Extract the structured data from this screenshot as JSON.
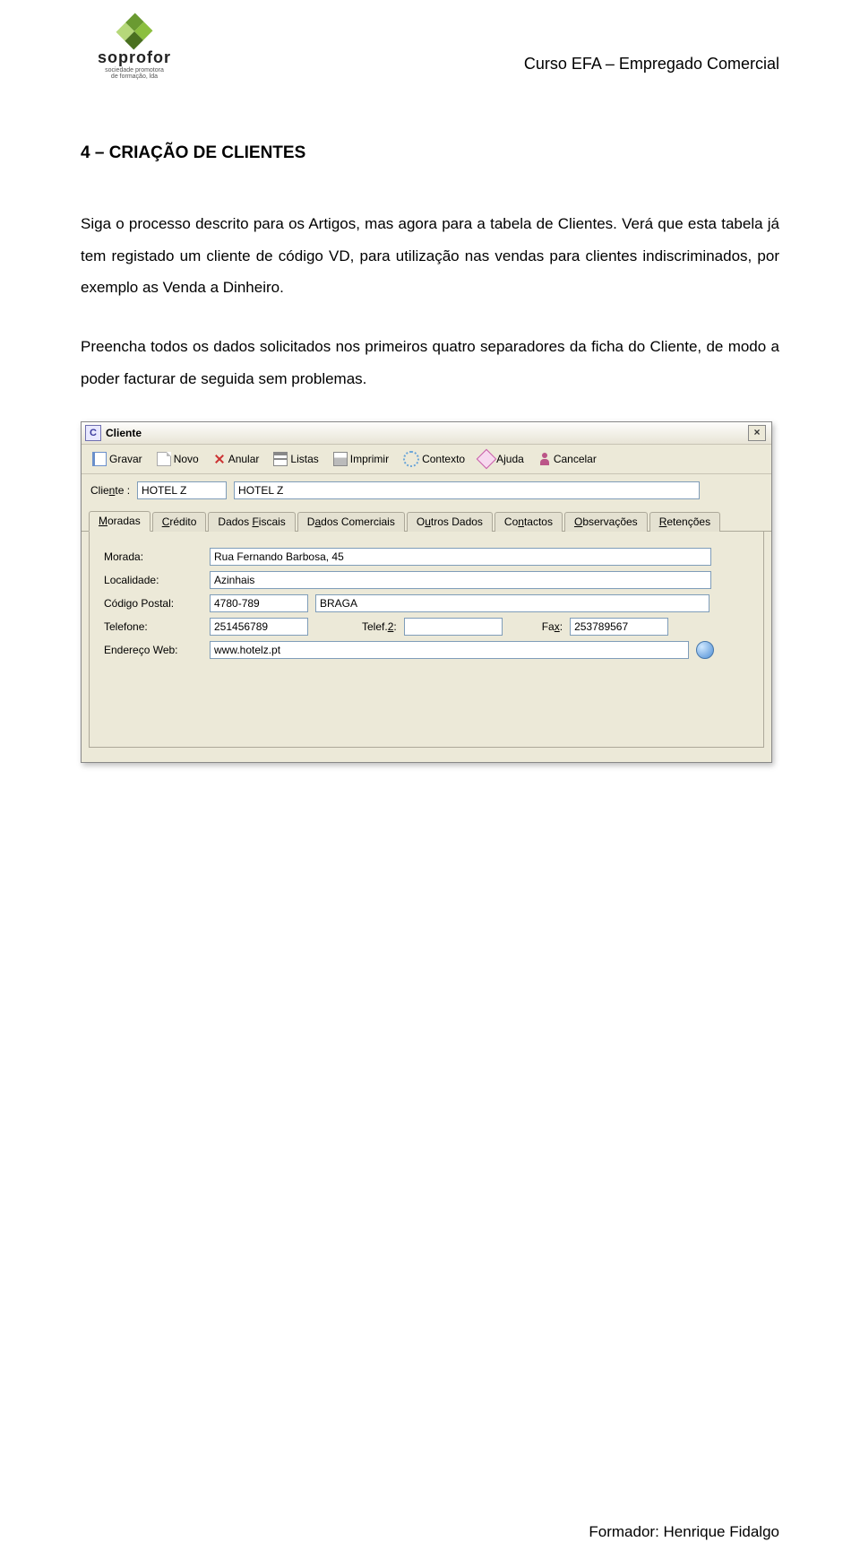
{
  "header": {
    "logo_word": "soprofor",
    "logo_sub1": "sociedade promotora",
    "logo_sub2": "de formação, lda",
    "course": "Curso EFA – Empregado Comercial"
  },
  "section_title": "4 – CRIAÇÃO DE CLIENTES",
  "para1": "Siga o processo descrito para os Artigos, mas agora para a tabela de Clientes. Verá que esta tabela já tem registado um cliente de código VD, para utilização nas vendas para clientes indiscriminados, por exemplo as Venda a Dinheiro.",
  "para2": "Preencha todos os dados solicitados nos primeiros quatro separadores da ficha do Cliente, de modo a poder facturar de seguida sem problemas.",
  "win": {
    "icon_glyph": "C",
    "title": "Cliente",
    "close": "×",
    "toolbar": {
      "save": "Gravar",
      "new": "Novo",
      "annul": "Anular",
      "lists": "Listas",
      "print": "Imprimir",
      "ctx": "Contexto",
      "help": "Ajuda",
      "cancel": "Cancelar"
    },
    "cliente_label_pre": "Clie",
    "cliente_label_ul": "n",
    "cliente_label_post": "te :",
    "cliente_code": "HOTEL Z",
    "cliente_name": "HOTEL Z",
    "tabs": [
      {
        "id": "moradas",
        "ul": "M",
        "pre": "",
        "post": "oradas",
        "active": true
      },
      {
        "id": "credito",
        "ul": "C",
        "pre": "",
        "post": "rédito",
        "active": false
      },
      {
        "id": "fiscais",
        "ul": "F",
        "pre": "Dados ",
        "post": "iscais",
        "active": false
      },
      {
        "id": "comerciais",
        "ul": "a",
        "pre": "D",
        "post": "dos Comerciais",
        "active": false
      },
      {
        "id": "outros",
        "ul": "u",
        "pre": "O",
        "post": "tros Dados",
        "active": false
      },
      {
        "id": "contactos",
        "ul": "n",
        "pre": "Co",
        "post": "tactos",
        "active": false
      },
      {
        "id": "obs",
        "ul": "O",
        "pre": "",
        "post": "bservações",
        "active": false
      },
      {
        "id": "retencoes",
        "ul": "R",
        "pre": "",
        "post": "etenções",
        "active": false
      }
    ],
    "fields": {
      "morada_label_pre": "Mora",
      "morada_label_ul": "d",
      "morada_label_post": "a:",
      "morada": "Rua Fernando Barbosa, 45",
      "localidade_label_pre": "",
      "localidade_label_ul": "L",
      "localidade_label_post": "ocalidade:",
      "localidade": "Azinhais",
      "cp_label_pre": "Código ",
      "cp_label_ul": "P",
      "cp_label_post": "ostal:",
      "cp": "4780-789",
      "cp_city": "BRAGA",
      "tel_label_pre": "Telefo",
      "tel_label_ul": "n",
      "tel_label_post": "e:",
      "tel": "251456789",
      "tel2_label_pre": "Telef.",
      "tel2_label_ul": "2",
      "tel2_label_post": ":",
      "tel2": "",
      "fax_label_pre": "Fa",
      "fax_label_ul": "x",
      "fax_label_post": ":",
      "fax": "253789567",
      "web_label_pre": "Endereço ",
      "web_label_ul": "W",
      "web_label_post": "eb:",
      "web": "www.hotelz.pt"
    }
  },
  "footer": "Formador: Henrique Fidalgo"
}
